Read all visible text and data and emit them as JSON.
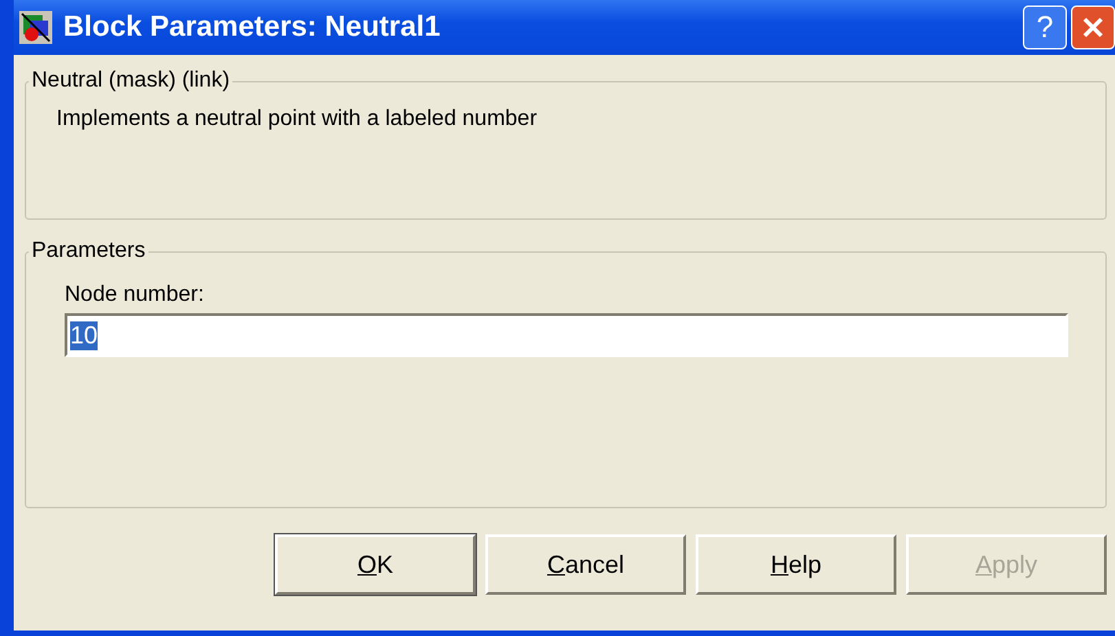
{
  "window": {
    "title": "Block Parameters: Neutral1",
    "help_button": "?"
  },
  "description_group": {
    "title": "Neutral (mask) (link)",
    "text": "Implements a neutral point with a labeled number"
  },
  "parameters_group": {
    "title": "Parameters",
    "fields": [
      {
        "label": "Node number:",
        "value": "10",
        "selected": true
      }
    ]
  },
  "buttons": [
    {
      "label": "OK",
      "default": true,
      "disabled": false
    },
    {
      "label": "Cancel",
      "default": false,
      "disabled": false
    },
    {
      "label": "Help",
      "default": false,
      "disabled": false
    },
    {
      "label": "Apply",
      "default": false,
      "disabled": true
    }
  ]
}
